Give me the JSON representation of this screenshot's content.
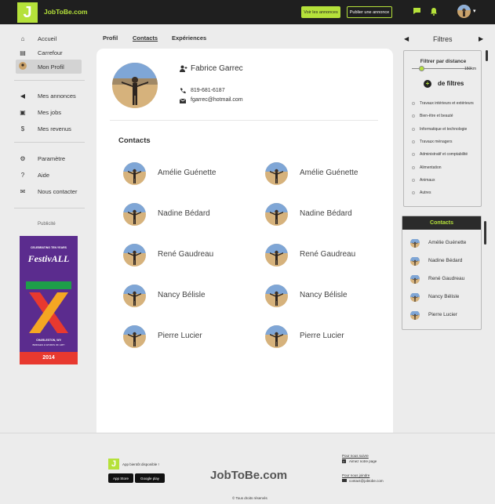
{
  "header": {
    "logo_letter": "J",
    "logo_text": "JobToBe.com",
    "btn_view_ads": "Voir les annonces",
    "btn_post_ad": "Publier une annonce",
    "icons": [
      "chat-icon",
      "bell-icon"
    ]
  },
  "sidebar": {
    "items": [
      {
        "label": "Accueil",
        "icon": "home-icon"
      },
      {
        "label": "Carrefour",
        "icon": "board-icon"
      },
      {
        "label": "Mon Profil",
        "icon": "avatar"
      },
      {
        "label": "Mes annonces",
        "icon": "megaphone-icon"
      },
      {
        "label": "Mes jobs",
        "icon": "briefcase-icon"
      },
      {
        "label": "Mes revenus",
        "icon": "money-icon"
      },
      {
        "label": "Paramètre",
        "icon": "gear-icon"
      },
      {
        "label": "Aide",
        "icon": "help-icon"
      },
      {
        "label": "Nous contacter",
        "icon": "mail-icon"
      }
    ],
    "pub_label": "Publicité",
    "ad": {
      "top_text": "CELEBRATING TEN YEARS",
      "brand": "FestivALL",
      "city": "CHARLESTON, WV",
      "sub": "BRIDGES & WORKS OF ART!",
      "year": "2014"
    }
  },
  "tabs": [
    "Profil",
    "Contacts",
    "Expériences"
  ],
  "profile": {
    "name": "Fabrice Garrec",
    "phone": "819-681-6187",
    "email": "fgarrec@hotmail.com"
  },
  "contacts_title": "Contacts",
  "contacts": [
    "Amélie Guénette",
    "Amélie Guénette",
    "Nadine Bédard",
    "Nadine Bédard",
    "René Gaudreau",
    "René Gaudreau",
    "Nancy Bélisle",
    "Nancy Bélisle",
    "Pierre Lucier",
    "Pierre Lucier"
  ],
  "filters": {
    "title": "Filtres",
    "distance_title": "Filtrer par distance",
    "distance_value": "150km",
    "distance_fraction": 0.17,
    "more_label": "de filtres",
    "options": [
      "Travaux intérieurs et extérieurs",
      "Bien-être et beauté",
      "Informatique et technologie",
      "Travaux ménagers",
      "Administratif et comptabilité",
      "Alimentation",
      "Animaux",
      "Autres"
    ]
  },
  "side_contacts": {
    "title": "Contacts",
    "items": [
      "Amélie Guénette",
      "Nadine Bédard",
      "René Gaudreau",
      "Nancy Bélisle",
      "Pierre Lucier"
    ]
  },
  "footer": {
    "app_text": "App bientôt disponible !",
    "app_store": "App Store",
    "google_play": "Google play",
    "brand": "JobToBe.com",
    "follow_title": "Pour nous suivre",
    "follow_text": "Aimez notre page",
    "contact_title": "Pour nous joindre",
    "contact_email": "contact@jobtobe.com",
    "rights": "Tous droits réservés"
  }
}
